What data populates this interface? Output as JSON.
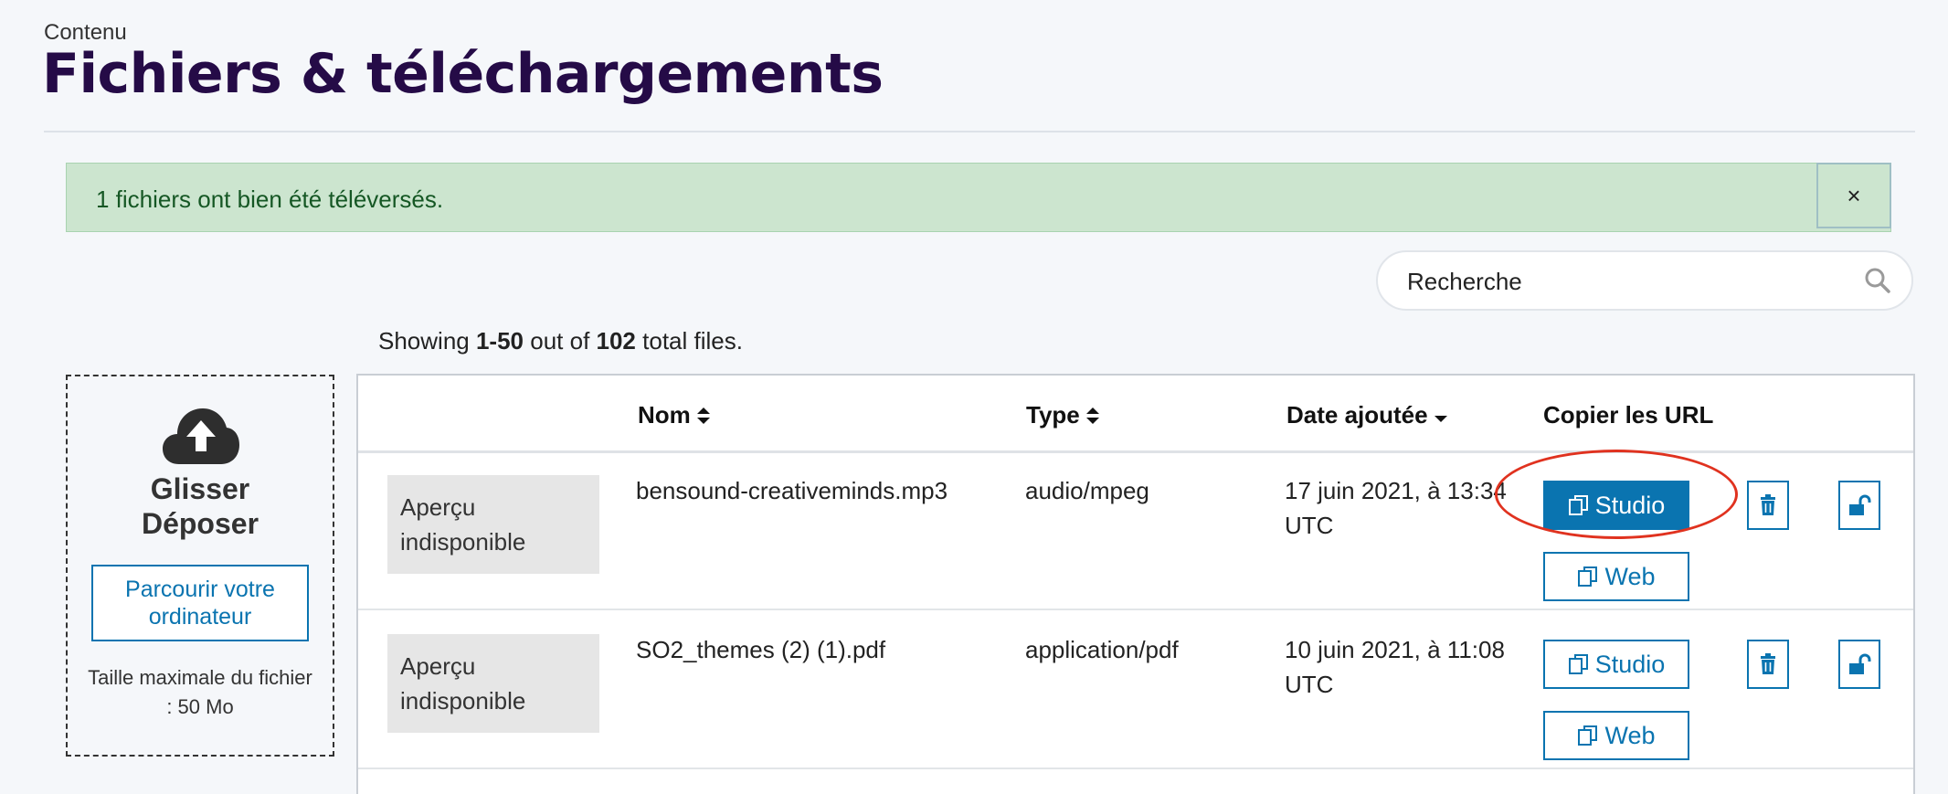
{
  "breadcrumb": "Contenu",
  "page_title": "Fichiers & téléchargements",
  "alert": {
    "message": "1 fichiers ont bien été téléversés.",
    "close_label": "×"
  },
  "search": {
    "placeholder": "Recherche"
  },
  "showing": {
    "prefix": "Showing ",
    "range": "1-50",
    "middle": " out of ",
    "total": "102",
    "suffix": " total files."
  },
  "dropzone": {
    "title_line1": "Glisser",
    "title_line2": "Déposer",
    "browse_label": "Parcourir votre ordinateur",
    "max_size": "Taille maximale du fichier : 50 Mo"
  },
  "table": {
    "columns": {
      "name": "Nom",
      "type": "Type",
      "date": "Date ajoutée",
      "copy": "Copier les URL"
    },
    "rows": [
      {
        "preview": "Aperçu indisponible",
        "name": "bensound-creativeminds.mp3",
        "type": "audio/mpeg",
        "date": "17 juin 2021, à 13:34 UTC",
        "studio_label": "Studio",
        "web_label": "Web"
      },
      {
        "preview": "Aperçu indisponible",
        "name": "SO2_themes (2) (1).pdf",
        "type": "application/pdf",
        "date": "10 juin 2021, à 11:08 UTC",
        "studio_label": "Studio",
        "web_label": "Web"
      }
    ]
  },
  "icons": {
    "search": "search-icon",
    "upload": "cloud-upload-icon",
    "sort": "sort-icon",
    "copy": "copy-icon",
    "delete": "trash-icon",
    "visibility": "unlock-icon"
  },
  "colors": {
    "primary": "#0a74b0",
    "title": "#250b47",
    "alert_bg": "#cce5cf",
    "highlight": "#e0321f"
  }
}
